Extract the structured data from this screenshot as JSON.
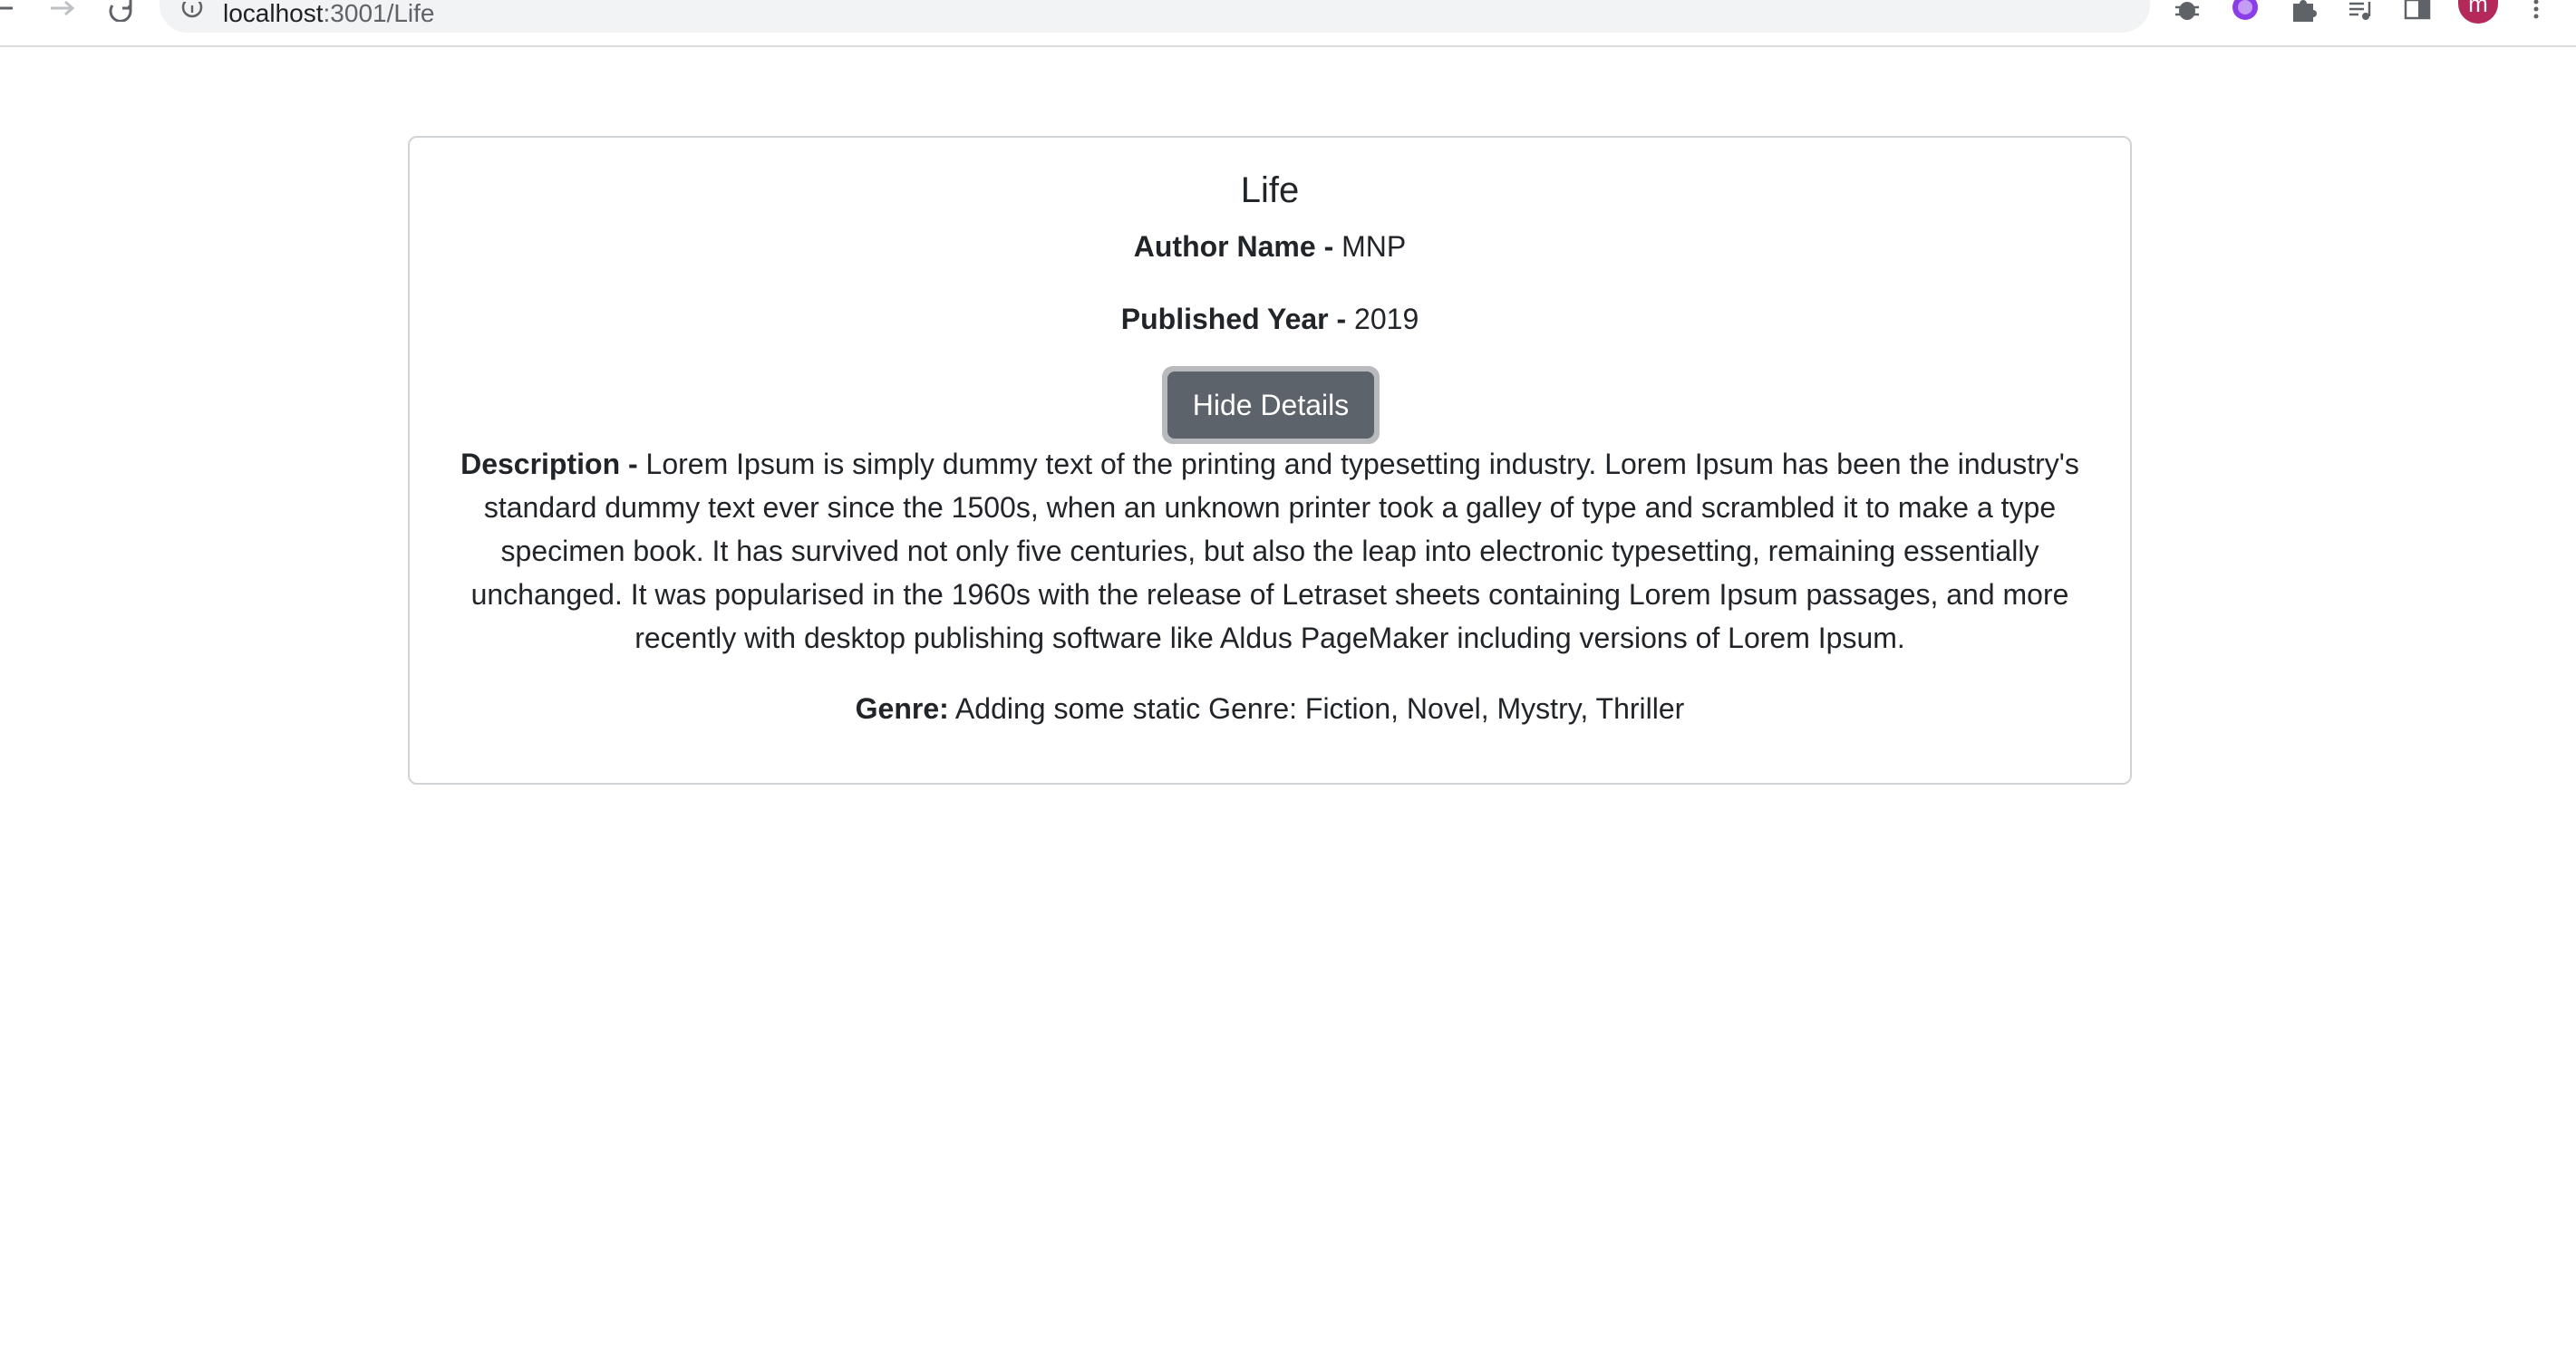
{
  "browser": {
    "url_host": "localhost",
    "url_path": ":3001/Life",
    "avatar_initial": "m"
  },
  "book": {
    "title": "Life",
    "author_label": "Author Name - ",
    "author_value": "MNP",
    "year_label": "Published Year - ",
    "year_value": "2019",
    "toggle_button": "Hide Details",
    "description_label": "Description - ",
    "description_value": "Lorem Ipsum is simply dummy text of the printing and typesetting industry. Lorem Ipsum has been the industry's standard dummy text ever since the 1500s, when an unknown printer took a galley of type and scrambled it to make a type specimen book. It has survived not only five centuries, but also the leap into electronic typesetting, remaining essentially unchanged. It was popularised in the 1960s with the release of Letraset sheets containing Lorem Ipsum passages, and more recently with desktop publishing software like Aldus PageMaker including versions of Lorem Ipsum.",
    "genre_label": "Genre:",
    "genre_value": " Adding some static Genre: Fiction, Novel, Mystry, Thriller"
  },
  "colors": {
    "button_bg": "#5c636a",
    "button_focus_ring": "#b8babd",
    "card_border": "#d0d3d6",
    "avatar": "#b5285a"
  }
}
